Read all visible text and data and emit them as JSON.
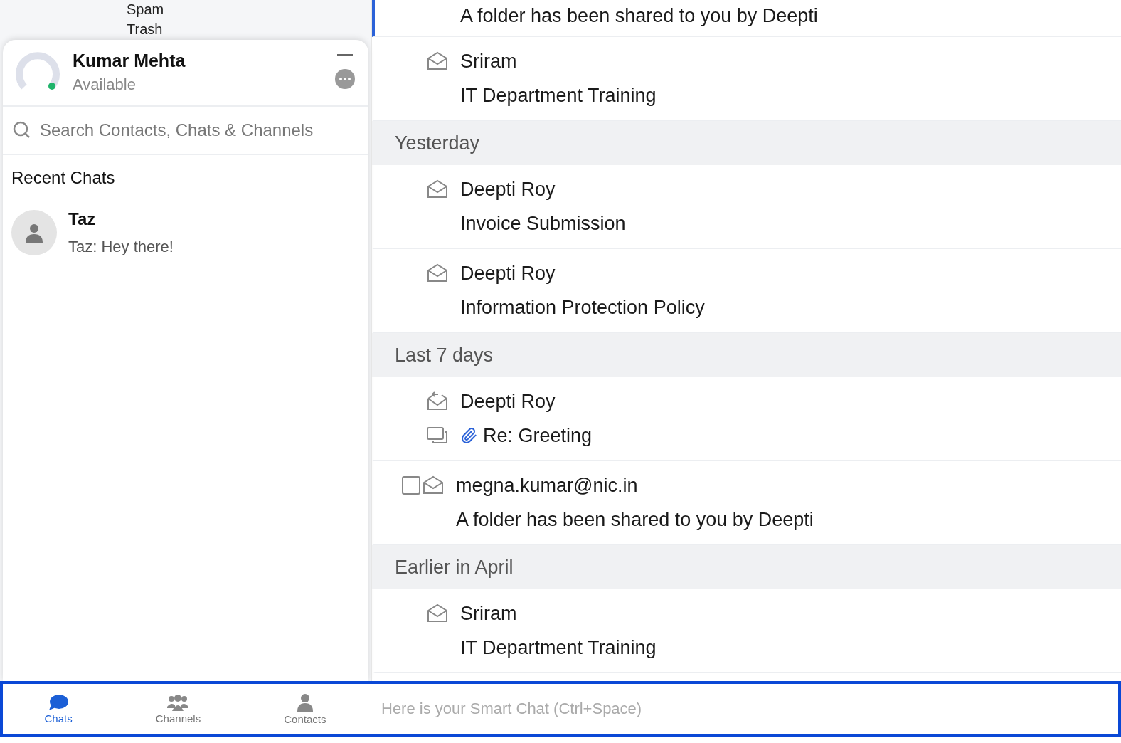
{
  "folders": [
    {
      "label": "Spam"
    },
    {
      "label": "Trash"
    }
  ],
  "profile": {
    "name": "Kumar Mehta",
    "status": "Available",
    "online": true
  },
  "search": {
    "placeholder": "Search Contacts, Chats & Channels"
  },
  "recent_chats": {
    "title": "Recent Chats",
    "items": [
      {
        "name": "Taz",
        "preview": "Taz: Hey there!"
      }
    ]
  },
  "mail_list": [
    {
      "kind": "mail",
      "subject": "A folder has been shared to you by Deepti",
      "selected": true,
      "attachment": false
    },
    {
      "kind": "mail",
      "sender": "Sriram",
      "subject": "IT Department Training",
      "selected": false,
      "attachment": false
    },
    {
      "kind": "header",
      "label": "Yesterday"
    },
    {
      "kind": "mail",
      "sender": "Deepti Roy",
      "subject": "Invoice Submission",
      "selected": false,
      "attachment": false
    },
    {
      "kind": "mail",
      "sender": "Deepti Roy",
      "subject": "Information Protection Policy",
      "selected": false,
      "attachment": false
    },
    {
      "kind": "header",
      "label": "Last 7 days"
    },
    {
      "kind": "thread",
      "sender": "Deepti Roy",
      "subject": "Re: Greeting",
      "selected": false,
      "attachment": true
    },
    {
      "kind": "checkable",
      "sender": "megna.kumar@nic.in",
      "subject": "A folder has been shared to you by Deepti",
      "selected": false,
      "checked": false,
      "attachment": false
    },
    {
      "kind": "header",
      "label": "Earlier in April"
    },
    {
      "kind": "mail",
      "sender": "Sriram",
      "subject": "IT Department Training",
      "selected": false,
      "attachment": false
    }
  ],
  "bottom_tabs": [
    {
      "label": "Chats",
      "selected": true
    },
    {
      "label": "Channels",
      "selected": false
    },
    {
      "label": "Contacts",
      "selected": false
    }
  ],
  "smart_chat": {
    "placeholder": "Here is your Smart Chat (Ctrl+Space)"
  }
}
